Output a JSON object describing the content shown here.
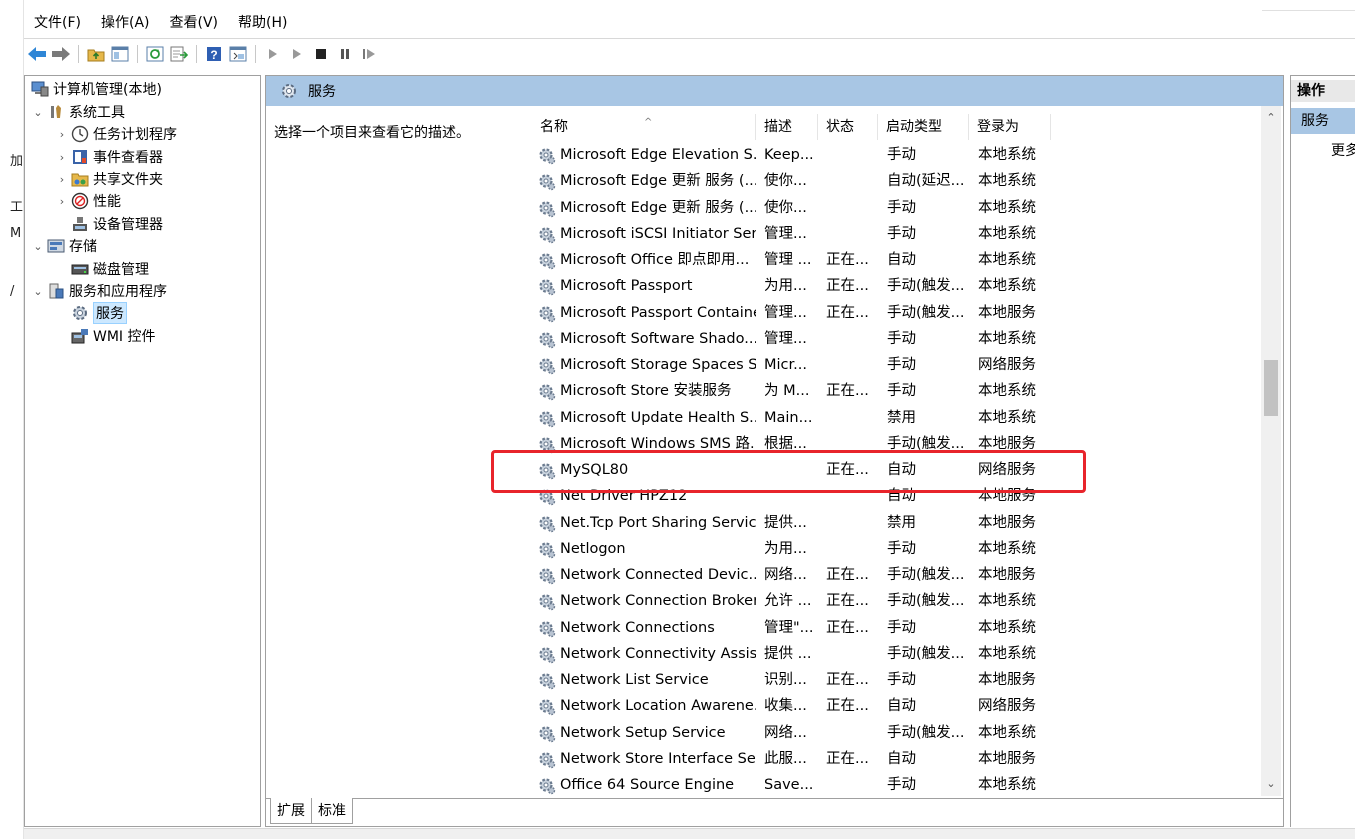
{
  "menubar": {
    "items": [
      "文件(F)",
      "操作(A)",
      "查看(V)",
      "帮助(H)"
    ]
  },
  "left_edge": {
    "chars": [
      "加",
      "工",
      "M",
      "/"
    ]
  },
  "tree": {
    "root": "计算机管理(本地)",
    "items": [
      {
        "label": "系统工具",
        "level": 1,
        "expanded": true,
        "icon": "tools-icon"
      },
      {
        "label": "任务计划程序",
        "level": 2,
        "icon": "clock-icon"
      },
      {
        "label": "事件查看器",
        "level": 2,
        "icon": "event-viewer-icon"
      },
      {
        "label": "共享文件夹",
        "level": 2,
        "icon": "shared-folder-icon"
      },
      {
        "label": "性能",
        "level": 2,
        "icon": "performance-icon"
      },
      {
        "label": "设备管理器",
        "level": 2,
        "icon": "device-manager-icon"
      },
      {
        "label": "存储",
        "level": 1,
        "expanded": true,
        "icon": "storage-icon"
      },
      {
        "label": "磁盘管理",
        "level": 2,
        "icon": "disk-icon"
      },
      {
        "label": "服务和应用程序",
        "level": 1,
        "expanded": true,
        "icon": "apps-icon"
      },
      {
        "label": "服务",
        "level": 2,
        "icon": "services-icon",
        "selected": true
      },
      {
        "label": "WMI 控件",
        "level": 2,
        "icon": "wmi-icon"
      }
    ]
  },
  "center": {
    "header_title": "服务",
    "description_prompt": "选择一个项目来查看它的描述。",
    "columns": [
      "名称",
      "描述",
      "状态",
      "启动类型",
      "登录为"
    ],
    "rows": [
      {
        "name": "Microsoft Edge Elevation S...",
        "desc": "Keep...",
        "status": "",
        "start": "手动",
        "logon": "本地系统"
      },
      {
        "name": "Microsoft Edge 更新 服务 (...",
        "desc": "使你...",
        "status": "",
        "start": "自动(延迟...",
        "logon": "本地系统"
      },
      {
        "name": "Microsoft Edge 更新 服务 (...",
        "desc": "使你...",
        "status": "",
        "start": "手动",
        "logon": "本地系统"
      },
      {
        "name": "Microsoft iSCSI Initiator Ser...",
        "desc": "管理...",
        "status": "",
        "start": "手动",
        "logon": "本地系统"
      },
      {
        "name": "Microsoft Office 即点即用...",
        "desc": "管理 ...",
        "status": "正在...",
        "start": "自动",
        "logon": "本地系统"
      },
      {
        "name": "Microsoft Passport",
        "desc": "为用...",
        "status": "正在...",
        "start": "手动(触发...",
        "logon": "本地系统"
      },
      {
        "name": "Microsoft Passport Container",
        "desc": "管理...",
        "status": "正在...",
        "start": "手动(触发...",
        "logon": "本地服务"
      },
      {
        "name": "Microsoft Software Shado...",
        "desc": "管理...",
        "status": "",
        "start": "手动",
        "logon": "本地系统"
      },
      {
        "name": "Microsoft Storage Spaces S...",
        "desc": "Micr...",
        "status": "",
        "start": "手动",
        "logon": "网络服务"
      },
      {
        "name": "Microsoft Store 安装服务",
        "desc": "为 M...",
        "status": "正在...",
        "start": "手动",
        "logon": "本地系统"
      },
      {
        "name": "Microsoft Update Health S...",
        "desc": "Main...",
        "status": "",
        "start": "禁用",
        "logon": "本地系统"
      },
      {
        "name": "Microsoft Windows SMS 路...",
        "desc": "根据...",
        "status": "",
        "start": "手动(触发...",
        "logon": "本地服务"
      },
      {
        "name": "MySQL80",
        "desc": "",
        "status": "正在...",
        "start": "自动",
        "logon": "网络服务"
      },
      {
        "name": "Net Driver HPZ12",
        "desc": "",
        "status": "",
        "start": "自动",
        "logon": "本地服务"
      },
      {
        "name": "Net.Tcp Port Sharing Service",
        "desc": "提供...",
        "status": "",
        "start": "禁用",
        "logon": "本地服务"
      },
      {
        "name": "Netlogon",
        "desc": "为用...",
        "status": "",
        "start": "手动",
        "logon": "本地系统"
      },
      {
        "name": "Network Connected Devic...",
        "desc": "网络...",
        "status": "正在...",
        "start": "手动(触发...",
        "logon": "本地服务"
      },
      {
        "name": "Network Connection Broker",
        "desc": "允许 ...",
        "status": "正在...",
        "start": "手动(触发...",
        "logon": "本地系统"
      },
      {
        "name": "Network Connections",
        "desc": "管理\"...",
        "status": "正在...",
        "start": "手动",
        "logon": "本地系统"
      },
      {
        "name": "Network Connectivity Assis...",
        "desc": "提供 ...",
        "status": "",
        "start": "手动(触发...",
        "logon": "本地系统"
      },
      {
        "name": "Network List Service",
        "desc": "识别...",
        "status": "正在...",
        "start": "手动",
        "logon": "本地服务"
      },
      {
        "name": "Network Location Awarene...",
        "desc": "收集...",
        "status": "正在...",
        "start": "自动",
        "logon": "网络服务"
      },
      {
        "name": "Network Setup Service",
        "desc": "网络...",
        "status": "",
        "start": "手动(触发...",
        "logon": "本地系统"
      },
      {
        "name": "Network Store Interface Se...",
        "desc": "此服...",
        "status": "正在...",
        "start": "自动",
        "logon": "本地服务"
      },
      {
        "name": "Office 64 Source Engine",
        "desc": "Save...",
        "status": "",
        "start": "手动",
        "logon": "本地系统"
      }
    ],
    "highlighted_service": "MySQL80",
    "highlight_color": "#e8242b",
    "tabs": [
      "扩展",
      "标准"
    ]
  },
  "actions": {
    "header": "操作",
    "section": "服务",
    "more": "更多"
  },
  "colors": {
    "header_blue": "#a8c6e4",
    "selection": "#cce8ff"
  }
}
